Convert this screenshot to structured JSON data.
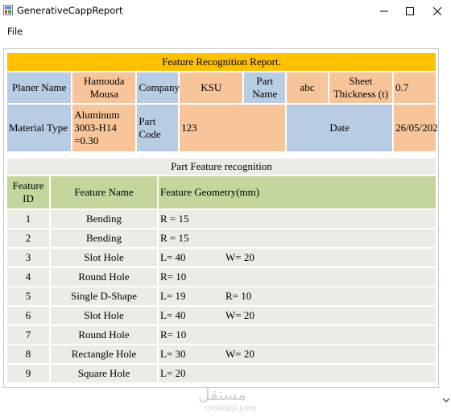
{
  "window": {
    "title": "GenerativeCappReport",
    "minimize_glyph": "—",
    "maximize_glyph": "☐",
    "close_glyph": "✕"
  },
  "menu": {
    "file": "File"
  },
  "report": {
    "title": "Feature Recognition Report.",
    "planer_name_label": "Planer Name",
    "planer_name_value": "Hamouda Mousa",
    "company_label": "Company",
    "company_value": "KSU",
    "part_name_label": "Part Name",
    "part_name_value": "abc",
    "sheet_thickness_label": "Sheet Thickness (t)",
    "sheet_thickness_value": "0.7",
    "material_type_label": "Material Type",
    "material_type_value": "Aluminum 3003-H14 =0.30",
    "part_code_label": "Part Code",
    "part_code_value": "123",
    "date_label": "Date",
    "date_value": "26/05/2022"
  },
  "features": {
    "section_title": "Part Feature recognition",
    "col_id": "Feature ID",
    "col_name": "Feature Name",
    "col_geometry": "Feature Geometry(mm)",
    "rows": [
      {
        "id": "1",
        "name": "Bending",
        "geo1": "R = 15",
        "geo2": ""
      },
      {
        "id": "2",
        "name": "Bending",
        "geo1": "R = 15",
        "geo2": ""
      },
      {
        "id": "3",
        "name": "Slot Hole",
        "geo1": "L= 40",
        "geo2": "W= 20"
      },
      {
        "id": "4",
        "name": "Round Hole",
        "geo1": "R= 10",
        "geo2": ""
      },
      {
        "id": "5",
        "name": "Single D-Shape",
        "geo1": "L= 19",
        "geo2": "R= 10"
      },
      {
        "id": "6",
        "name": "Slot Hole",
        "geo1": "L= 40",
        "geo2": "W= 20"
      },
      {
        "id": "7",
        "name": "Round Hole",
        "geo1": "R= 10",
        "geo2": ""
      },
      {
        "id": "8",
        "name": "Rectangle Hole",
        "geo1": "L= 30",
        "geo2": "W= 20"
      },
      {
        "id": "9",
        "name": "Square Hole",
        "geo1": "L= 20",
        "geo2": ""
      }
    ]
  },
  "watermark": {
    "arabic": "مستقل",
    "latin": "mostaql.com"
  },
  "colors": {
    "header_yellow": "#ffc000",
    "label_blue": "#b8cce4",
    "value_peach": "#f8c49a",
    "column_green": "#c3d69b",
    "row_grey": "#ecebe6"
  }
}
